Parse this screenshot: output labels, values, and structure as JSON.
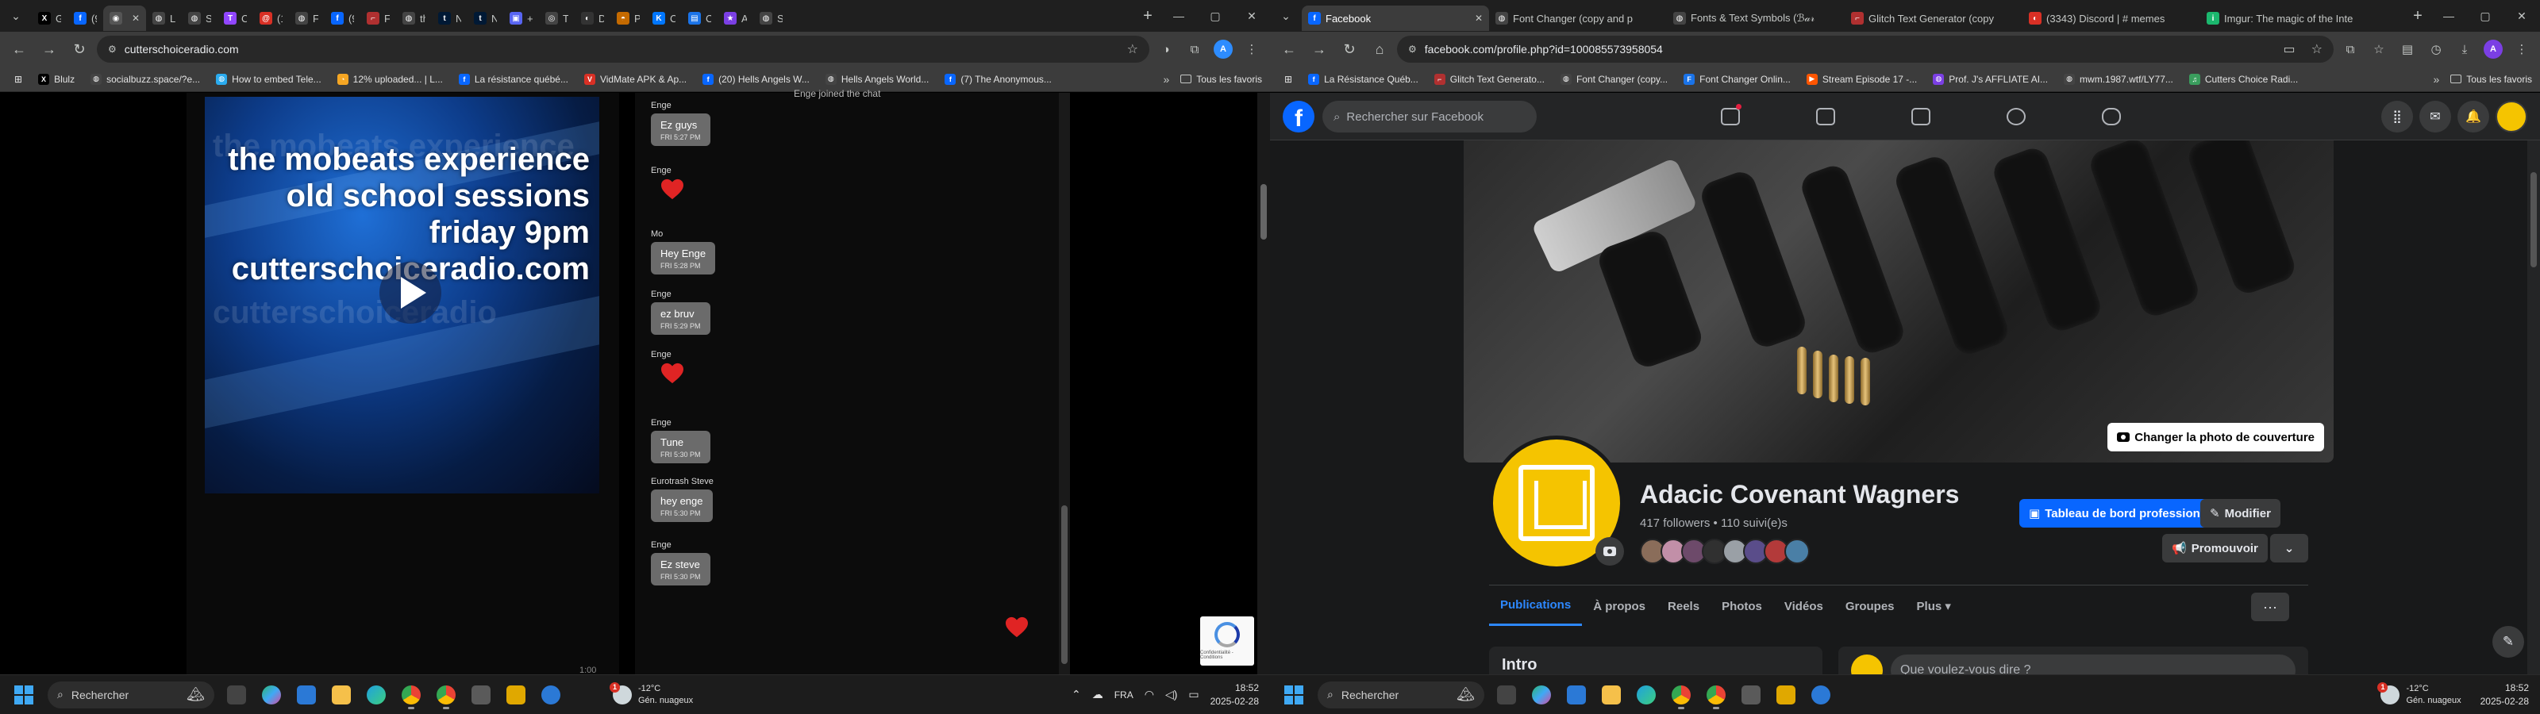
{
  "colors": {
    "chrome_tabstrip": "#1f1f1f",
    "chrome_toolbar": "#3c3c3c",
    "fb_blue": "#0866ff",
    "fb_dark": "#18191a",
    "profile_yellow": "#f5c400",
    "chat_bubble": "#6b6b6b",
    "heart_red": "#e02424"
  },
  "left": {
    "tabs": [
      {
        "label": "Gli",
        "icon": "x-icon",
        "color": "#000000",
        "glyph": "X"
      },
      {
        "label": "(9)",
        "icon": "facebook-icon",
        "color": "#0866ff",
        "glyph": "f"
      },
      {
        "label": "",
        "icon": "site-icon",
        "color": "#555555",
        "glyph": "◉",
        "active": true
      },
      {
        "label": "Lo",
        "icon": "globe-icon",
        "color": "#444444",
        "glyph": "◍"
      },
      {
        "label": "Se",
        "icon": "globe-icon",
        "color": "#444444",
        "glyph": "◍"
      },
      {
        "label": "CC",
        "icon": "twitch-icon",
        "color": "#9146ff",
        "glyph": "T"
      },
      {
        "label": "(1)",
        "icon": "threads-icon",
        "color": "#d93025",
        "glyph": "@"
      },
      {
        "label": "File",
        "icon": "globe-icon",
        "color": "#444444",
        "glyph": "◍"
      },
      {
        "label": "(9)",
        "icon": "facebook-icon",
        "color": "#0866ff",
        "glyph": "f"
      },
      {
        "label": "File",
        "icon": "file-icon",
        "color": "#b03030",
        "glyph": "⌐"
      },
      {
        "label": "the",
        "icon": "globe-icon",
        "color": "#444444",
        "glyph": "◍"
      },
      {
        "label": "Na",
        "icon": "tumblr-icon",
        "color": "#001935",
        "glyph": "t"
      },
      {
        "label": "Na",
        "icon": "tumblr-icon",
        "color": "#001935",
        "glyph": "t"
      },
      {
        "label": "+ #",
        "icon": "apps-icon",
        "color": "#5865f2",
        "glyph": "▣"
      },
      {
        "label": "Tra",
        "icon": "translate-icon",
        "color": "#444444",
        "glyph": "◎"
      },
      {
        "label": "Dis",
        "icon": "discord-icon",
        "color": "#333333",
        "glyph": "◐"
      },
      {
        "label": "Pri",
        "icon": "price-icon",
        "color": "#c46a00",
        "glyph": "◓"
      },
      {
        "label": "Cu",
        "icon": "vk-icon",
        "color": "#0077ff",
        "glyph": "K"
      },
      {
        "label": "Cu",
        "icon": "calendar-icon",
        "color": "#1a73e8",
        "glyph": "▤"
      },
      {
        "label": "Ad",
        "icon": "star-icon",
        "color": "#7b3fe4",
        "glyph": "★"
      },
      {
        "label": "Sc",
        "icon": "globe-icon",
        "color": "#444444",
        "glyph": "◍"
      }
    ],
    "url": "cutterschoiceradio.com",
    "bookmarks": [
      {
        "label": "Blulz",
        "icon": "x-icon",
        "color": "#000000",
        "glyph": "X"
      },
      {
        "label": "socialbuzz.space/?e...",
        "icon": "globe-icon",
        "color": "#444444",
        "glyph": "◍"
      },
      {
        "label": "How to embed Tele...",
        "icon": "globe-icon",
        "color": "#2aabee",
        "glyph": "◍"
      },
      {
        "label": "12% uploaded... | L...",
        "icon": "upload-icon",
        "color": "#f5a623",
        "glyph": "◔"
      },
      {
        "label": "La résistance québé...",
        "icon": "facebook-icon",
        "color": "#0866ff",
        "glyph": "f"
      },
      {
        "label": "VidMate APK & Ap...",
        "icon": "vidmate-icon",
        "color": "#d93025",
        "glyph": "V"
      },
      {
        "label": "(20) Hells Angels W...",
        "icon": "facebook-icon",
        "color": "#0866ff",
        "glyph": "f"
      },
      {
        "label": "Hells Angels World...",
        "icon": "globe-icon",
        "color": "#444444",
        "glyph": "◍"
      },
      {
        "label": "(7) The Anonymous...",
        "icon": "facebook-icon",
        "color": "#0866ff",
        "glyph": "f"
      }
    ],
    "all_bookmarks": "Tous les favoris",
    "video": {
      "line1": "the mobeats experience",
      "line2": "old school sessions",
      "line3": "friday 9pm",
      "line4": "cutterschoiceradio.com",
      "ghost1": "the mobeats experience",
      "ghost2": "cutterschoiceradio"
    },
    "chat": {
      "joined": "Enge joined the chat",
      "messages": [
        {
          "author": "Enge",
          "text": "Ez guys",
          "time": "FRI 5:27 PM"
        },
        {
          "author": "Enge",
          "heart": true
        },
        {
          "author": "Mo",
          "text": "Hey Enge",
          "time": "FRI 5:28 PM"
        },
        {
          "author": "Enge",
          "text": "ez bruv",
          "time": "FRI 5:29 PM"
        },
        {
          "author": "Enge",
          "heart": true
        },
        {
          "author": "Enge",
          "text": "Tune",
          "time": "FRI 5:30 PM"
        },
        {
          "author": "Eurotrash Steve",
          "text": "hey enge",
          "time": "FRI 5:30 PM"
        },
        {
          "author": "Enge",
          "text": "Ez steve",
          "time": "FRI 5:30 PM"
        }
      ]
    },
    "player_time": "1:00",
    "recaptcha_text": "Confidentialité - Conditions"
  },
  "right": {
    "tabs": [
      {
        "label": "Facebook",
        "icon": "facebook-icon",
        "color": "#0866ff",
        "glyph": "f",
        "active": true
      },
      {
        "label": "Font Changer (copy and p",
        "icon": "globe-icon",
        "color": "#444444",
        "glyph": "◍"
      },
      {
        "label": "Fonts & Text Symbols (ℬ𝒶𝓇",
        "icon": "globe-icon",
        "color": "#444444",
        "glyph": "◍"
      },
      {
        "label": "Glitch Text Generator (copy",
        "icon": "glitch-icon",
        "color": "#b03030",
        "glyph": "⌐"
      },
      {
        "label": "(3343) Discord | # memes",
        "icon": "discord-icon",
        "color": "#d93025",
        "glyph": "◐"
      },
      {
        "label": "Imgur: The magic of the Inte",
        "icon": "imgur-icon",
        "color": "#1bb76e",
        "glyph": "i"
      }
    ],
    "url": "facebook.com/profile.php?id=100085573958054",
    "bookmarks": [
      {
        "label": "La Résistance Québ...",
        "icon": "facebook-icon",
        "color": "#0866ff",
        "glyph": "f"
      },
      {
        "label": "Glitch Text Generato...",
        "icon": "glitch-icon",
        "color": "#b03030",
        "glyph": "⌐"
      },
      {
        "label": "Font Changer (copy...",
        "icon": "globe-icon",
        "color": "#444444",
        "glyph": "◍"
      },
      {
        "label": "Font Changer Onlin...",
        "icon": "font-icon",
        "color": "#1a73e8",
        "glyph": "F"
      },
      {
        "label": "Stream Episode 17 -...",
        "icon": "stream-icon",
        "color": "#ff5500",
        "glyph": "▶"
      },
      {
        "label": "Prof. J's AFFLIATE AI...",
        "icon": "globe-icon",
        "color": "#7b3fe4",
        "glyph": "◍"
      },
      {
        "label": "mwm.1987.wtf/LY77...",
        "icon": "globe-icon",
        "color": "#444444",
        "glyph": "◍"
      },
      {
        "label": "Cutters Choice Radi...",
        "icon": "radio-icon",
        "color": "#3a9d5d",
        "glyph": "♫"
      }
    ],
    "all_bookmarks": "Tous les favoris",
    "search_placeholder": "Rechercher sur Facebook",
    "cover_button": "Changer la photo de couverture",
    "profile_name": "Adacic Covenant Wagners",
    "followers": "417 followers • 110 suivi(e)s",
    "btn_dashboard": "Tableau de bord professionnel",
    "btn_edit": "Modifier",
    "btn_promote": "Promouvoir",
    "profile_tabs": [
      "Publications",
      "À propos",
      "Reels",
      "Photos",
      "Vidéos",
      "Groupes",
      "Plus ▾"
    ],
    "intro_title": "Intro",
    "composer_placeholder": "Que voulez-vous dire ?"
  },
  "taskbar": {
    "search": "Rechercher",
    "weather_temp": "-12°C",
    "weather_desc": "Gén. nuageux",
    "weather_badge": "1",
    "lang": "FRA",
    "time": "18:52",
    "date": "2025-02-28"
  }
}
